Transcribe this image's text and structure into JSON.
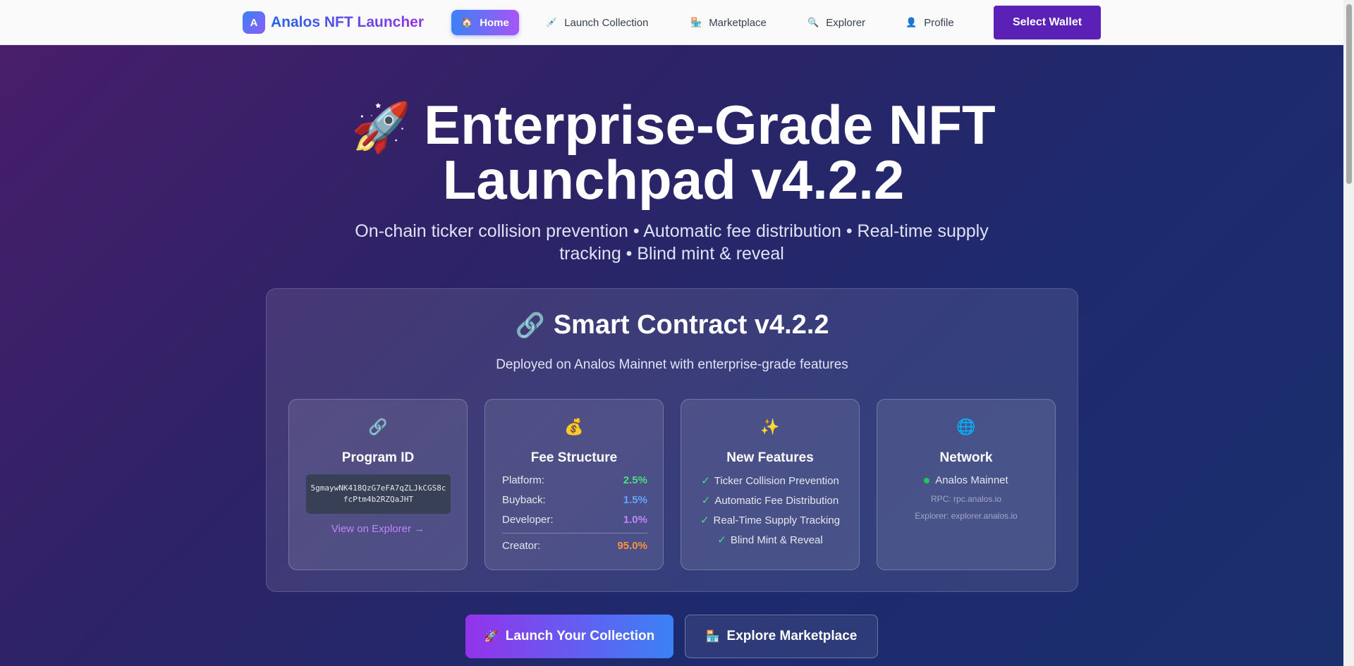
{
  "nav": {
    "brand_logo": "A",
    "brand_name": "Analos NFT Launcher",
    "items": [
      {
        "label": "Home",
        "icon": "house-icon",
        "glyph": "🏠"
      },
      {
        "label": "Launch Collection",
        "icon": "syringe-icon",
        "glyph": "💉"
      },
      {
        "label": "Marketplace",
        "icon": "store-icon",
        "glyph": "🏪"
      },
      {
        "label": "Explorer",
        "icon": "magnifier-icon",
        "glyph": "🔍"
      },
      {
        "label": "Profile",
        "icon": "user-icon",
        "glyph": "👤"
      }
    ],
    "active_index": 0,
    "wallet_button": "Select Wallet"
  },
  "hero": {
    "icon": "rocket-icon",
    "glyph": "🚀",
    "title": "Enterprise-Grade NFT Launchpad v4.2.2",
    "subtitle": "On-chain ticker collision prevention • Automatic fee distribution • Real-time supply tracking • Blind mint & reveal"
  },
  "contract": {
    "icon": "link-icon",
    "glyph": "🔗",
    "title": "Smart Contract v4.2.2",
    "subtitle": "Deployed on Analos Mainnet with enterprise-grade features",
    "program": {
      "icon": "link-icon",
      "glyph": "🔗",
      "title": "Program ID",
      "id": "5gmaywNK418QzG7eFA7qZLJkCGS8cfcPtm4b2RZQaJHT",
      "link": "View on Explorer →"
    },
    "fees": {
      "icon": "money-bag-icon",
      "glyph": "💰",
      "title": "Fee Structure",
      "rows": [
        {
          "label": "Platform:",
          "value": "2.5%",
          "color": "#4ade80"
        },
        {
          "label": "Buyback:",
          "value": "1.5%",
          "color": "#60a5fa"
        },
        {
          "label": "Developer:",
          "value": "1.0%",
          "color": "#c084fc"
        },
        {
          "label": "Creator:",
          "value": "95.0%",
          "color": "#fb923c"
        }
      ]
    },
    "features": {
      "icon": "sparkles-icon",
      "glyph": "✨",
      "title": "New Features",
      "check": "✓",
      "items": [
        "Ticker Collision Prevention",
        "Automatic Fee Distribution",
        "Real-Time Supply Tracking",
        "Blind Mint & Reveal"
      ]
    },
    "network": {
      "icon": "globe-icon",
      "glyph": "🌐",
      "title": "Network",
      "name": "Analos Mainnet",
      "rpc": "RPC: rpc.analos.io",
      "explorer": "Explorer: explorer.analos.io",
      "status_color": "#22c55e"
    }
  },
  "cta": {
    "launch": {
      "label": "Launch Your Collection",
      "icon": "rocket-icon",
      "glyph": "🚀"
    },
    "explore": {
      "label": "Explore Marketplace",
      "icon": "store-icon",
      "glyph": "🏪"
    }
  }
}
